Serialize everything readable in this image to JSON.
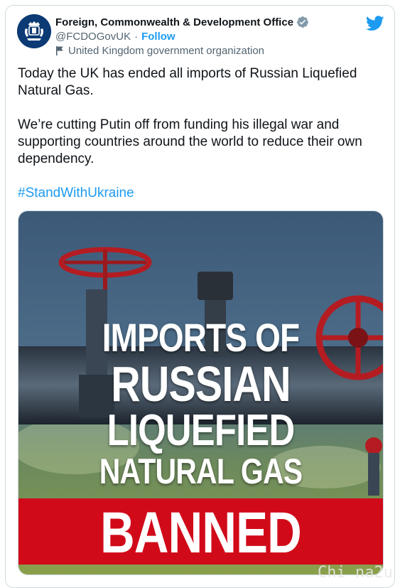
{
  "tweet": {
    "display_name": "Foreign, Commonwealth & Development Office",
    "handle": "@FCDOGovUK",
    "separator": "·",
    "follow_label": "Follow",
    "org_label": "United Kingdom government organization",
    "paragraphs": [
      "Today the UK has ended all imports of Russian Liquefied Natural Gas.",
      "We’re cutting Putin off from funding his illegal war and supporting countries around the world to reduce their own dependency."
    ],
    "hashtag": "#StandWithUkraine"
  },
  "media": {
    "headline_lines": [
      "IMPORTS OF",
      "RUSSIAN",
      "LIQUEFIED",
      "NATURAL GAS"
    ],
    "banner": "BANNED",
    "watermark": "Chi na2u"
  },
  "colors": {
    "link": "#1d9bf0",
    "banner_red": "#d10a1a",
    "text": "#0f1419",
    "muted": "#536471"
  },
  "icons": [
    "verified-badge-icon",
    "twitter-bird-icon",
    "flag-icon",
    "fcdo-crest-logo"
  ]
}
